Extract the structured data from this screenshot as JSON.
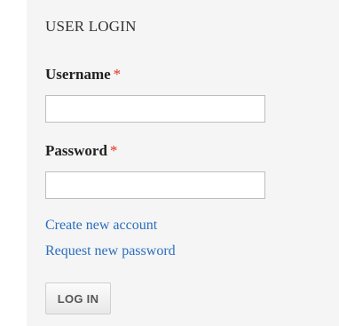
{
  "block": {
    "title": "USER LOGIN"
  },
  "form": {
    "username": {
      "label": "Username",
      "required_marker": "*",
      "value": "",
      "placeholder": ""
    },
    "password": {
      "label": "Password",
      "required_marker": "*",
      "value": "",
      "placeholder": ""
    },
    "submit_label": "LOG IN"
  },
  "links": {
    "create_account": "Create new account",
    "request_password": "Request new password"
  },
  "colors": {
    "panel_background": "#f5f5f5",
    "link": "#2a6ebf",
    "required_marker": "#e0311f"
  }
}
